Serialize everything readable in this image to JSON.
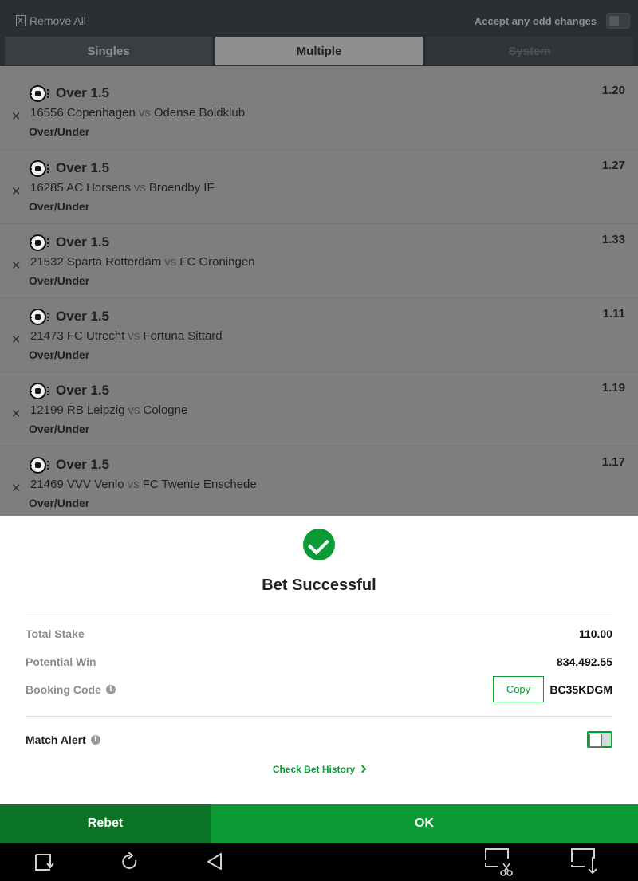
{
  "header": {
    "remove_all": "Remove All",
    "accept_odds": "Accept any odd changes"
  },
  "tabs": [
    {
      "label": "Singles",
      "state": "normal"
    },
    {
      "label": "Multiple",
      "state": "active"
    },
    {
      "label": "System",
      "state": "disabled"
    }
  ],
  "selections": [
    {
      "market": "Over 1.5",
      "odds": "1.20",
      "event_id": "16556",
      "home": "Copenhagen",
      "vs": "vs",
      "away": "Odense Boldklub",
      "type": "Over/Under"
    },
    {
      "market": "Over 1.5",
      "odds": "1.27",
      "event_id": "16285",
      "home": "AC Horsens",
      "vs": "vs",
      "away": "Broendby IF",
      "type": "Over/Under"
    },
    {
      "market": "Over 1.5",
      "odds": "1.33",
      "event_id": "21532",
      "home": "Sparta Rotterdam",
      "vs": "vs",
      "away": "FC Groningen",
      "type": "Over/Under"
    },
    {
      "market": "Over 1.5",
      "odds": "1.11",
      "event_id": "21473",
      "home": "FC Utrecht",
      "vs": "vs",
      "away": "Fortuna Sittard",
      "type": "Over/Under"
    },
    {
      "market": "Over 1.5",
      "odds": "1.19",
      "event_id": "12199",
      "home": "RB Leipzig",
      "vs": "vs",
      "away": "Cologne",
      "type": "Over/Under"
    },
    {
      "market": "Over 1.5",
      "odds": "1.17",
      "event_id": "21469",
      "home": "VVV Venlo",
      "vs": "vs",
      "away": "FC Twente Enschede",
      "type": "Over/Under"
    }
  ],
  "modal": {
    "title": "Bet Successful",
    "total_stake_label": "Total Stake",
    "total_stake": "110.00",
    "potential_win_label": "Potential Win",
    "potential_win": "834,492.55",
    "booking_code_label": "Booking Code",
    "copy_label": "Copy",
    "booking_code": "BC35KDGM",
    "match_alert_label": "Match Alert",
    "check_history": "Check Bet History"
  },
  "footer": {
    "rebet": "Rebet",
    "ok": "OK"
  },
  "colors": {
    "brand_green": "#0a9b34",
    "rebet_green": "#0b7425"
  }
}
